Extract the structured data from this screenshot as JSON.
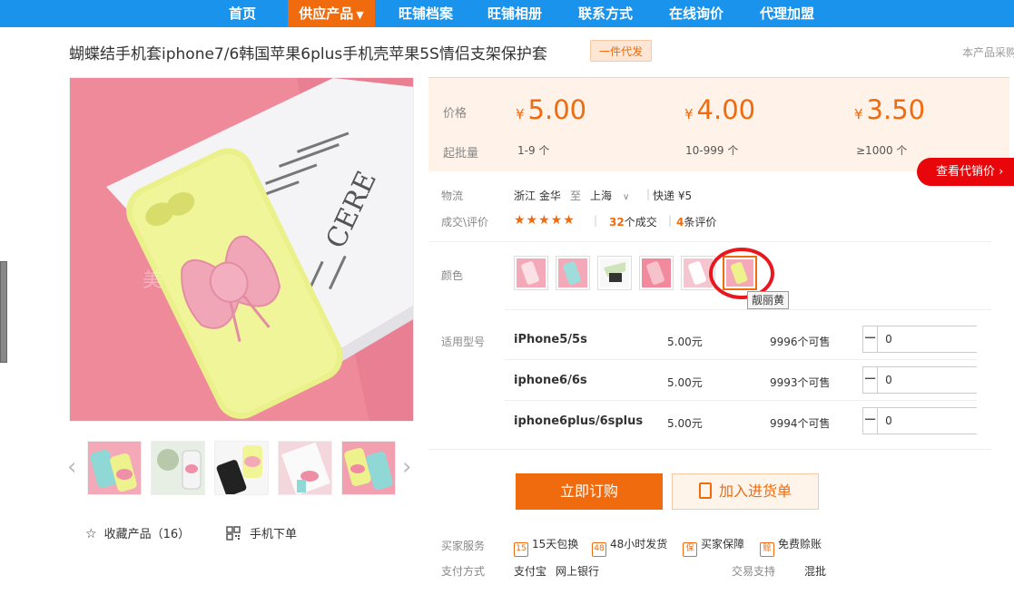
{
  "nav": {
    "items": [
      {
        "label": "首页"
      },
      {
        "label": "供应产品",
        "caret": "▼",
        "active": true
      },
      {
        "label": "旺铺档案"
      },
      {
        "label": "旺铺相册"
      },
      {
        "label": "联系方式"
      },
      {
        "label": "在线询价"
      },
      {
        "label": "代理加盟"
      }
    ]
  },
  "product": {
    "title": "蝴蝶结手机套iphone7/6韩国苹果6plus手机壳苹果5S情侣支架保护套",
    "badge": "一件代发",
    "note_right": "本产品采购"
  },
  "gallery": {
    "watermark": "美",
    "thumb_count": 5
  },
  "actions_left": {
    "favorite": "收藏产品（16）",
    "mobile_order": "手机下单"
  },
  "pricing": {
    "price_label": "价格",
    "moq_label": "起批量",
    "currency": "¥",
    "tiers": [
      {
        "price": "5.00",
        "qty": "1-9 个"
      },
      {
        "price": "4.00",
        "qty": "10-999 个"
      },
      {
        "price": "3.50",
        "qty": "≥1000 个"
      }
    ],
    "agent_price_button": "查看代销价 ›"
  },
  "logistics": {
    "label": "物流",
    "from": "浙江 金华",
    "to_word": "至",
    "to": "上海",
    "shipping": "快递 ¥5"
  },
  "reviews": {
    "label": "成交\\评价",
    "stars": "★★★★★",
    "deals_count": "32",
    "deals_suffix": "个成交",
    "review_count": "4",
    "review_suffix": "条评价"
  },
  "color": {
    "label": "颜色",
    "selected_tooltip": "靓丽黄",
    "swatch_count": 6,
    "selected_index": 5
  },
  "models": {
    "label": "适用型号",
    "rows": [
      {
        "name": "iPhone5/5s",
        "price": "5.00元",
        "stock": "9996个可售",
        "qty": "0"
      },
      {
        "name": "iphone6/6s",
        "price": "5.00元",
        "stock": "9993个可售",
        "qty": "0"
      },
      {
        "name": "iphone6plus/6splus",
        "price": "5.00元",
        "stock": "9994个可售",
        "qty": "0"
      }
    ]
  },
  "buttons": {
    "buy_now": "立即订购",
    "add_to_list": "加入进货单"
  },
  "services": {
    "label": "买家服务",
    "items": [
      {
        "icon": "15",
        "label": "15天包换"
      },
      {
        "icon": "48",
        "label": "48小时发货"
      },
      {
        "icon": "保",
        "label": "买家保障"
      },
      {
        "icon": "赊",
        "label": "免费赊账"
      }
    ]
  },
  "payment": {
    "label": "支付方式",
    "methods": [
      "支付宝",
      "网上银行"
    ],
    "trade_label": "交易支持",
    "trade_value": "混批"
  },
  "colors": {
    "nav_bg": "#1a93ec",
    "accent": "#f06a0e",
    "agent_red": "#e8060a"
  }
}
